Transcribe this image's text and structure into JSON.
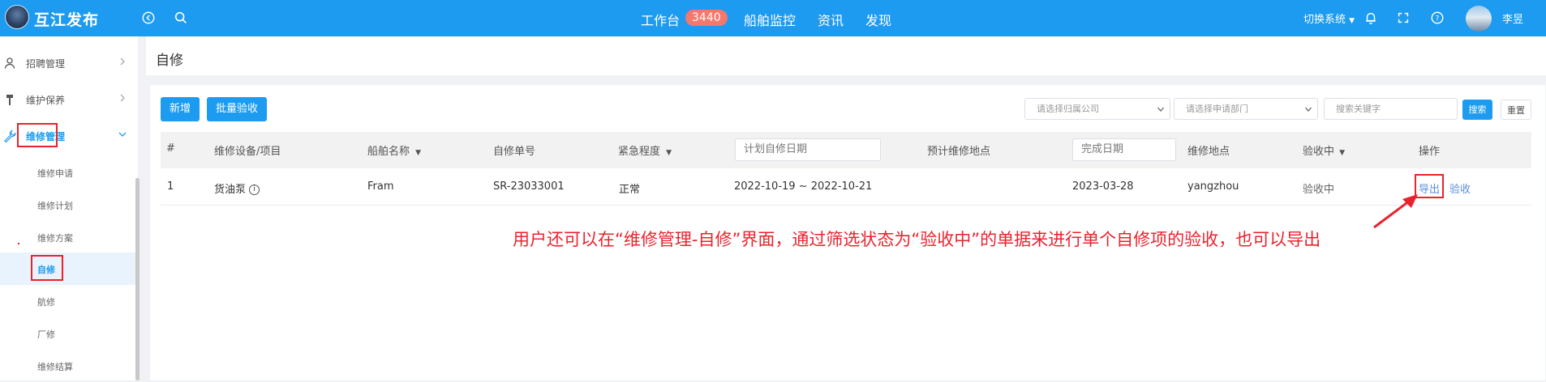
{
  "header": {
    "app_title": "互江发布",
    "nav": [
      "工作台",
      "船舶监控",
      "资讯",
      "发现"
    ],
    "workbench_count": "3440",
    "switch_label": "切换系统",
    "username": "李昱",
    "brand_color": "#1c9bf0"
  },
  "sidebar": {
    "items": [
      {
        "label": "招聘管理",
        "icon": "user-icon"
      },
      {
        "label": "维护保养",
        "icon": "hammer-icon"
      },
      {
        "label": "维修管理",
        "icon": "wrench-icon"
      }
    ],
    "sub_items": [
      "维修申请",
      "维修计划",
      "维修方案",
      "自修",
      "航修",
      "厂修",
      "维修结算"
    ],
    "active_sub": "自修"
  },
  "page": {
    "title": "自修"
  },
  "toolbar": {
    "add_label": "新增",
    "batch_label": "批量验收",
    "company_placeholder": "请选择归属公司",
    "dept_placeholder": "请选择申请部门",
    "search_placeholder": "搜索关键字",
    "search_label": "搜索",
    "reset_label": "重置"
  },
  "table": {
    "headers": {
      "index": "#",
      "equipment": "维修设备/项目",
      "ship": "船舶名称",
      "order": "自修单号",
      "urgency": "紧急程度",
      "plan_date": "计划自修日期",
      "location": "预计维修地点",
      "finish_date": "完成日期",
      "repair_site": "维修地点",
      "status": "验收中",
      "actions": "操作"
    },
    "rows": [
      {
        "index": "1",
        "equipment": "货油泵",
        "ship": "Fram",
        "order": "SR-23033001",
        "urgency": "正常",
        "plan_date": "2022-10-19 ~ 2022-10-21",
        "finish_date": "2023-03-28",
        "repair_site": "yangzhou",
        "status": "验收中",
        "export": "导出",
        "accept": "验收"
      }
    ]
  },
  "annotation": {
    "text": "用户还可以在“维修管理-自修”界面，通过筛选状态为“验收中”的单据来进行单个自修项的验收，也可以导出",
    "color": "#e8232d"
  }
}
